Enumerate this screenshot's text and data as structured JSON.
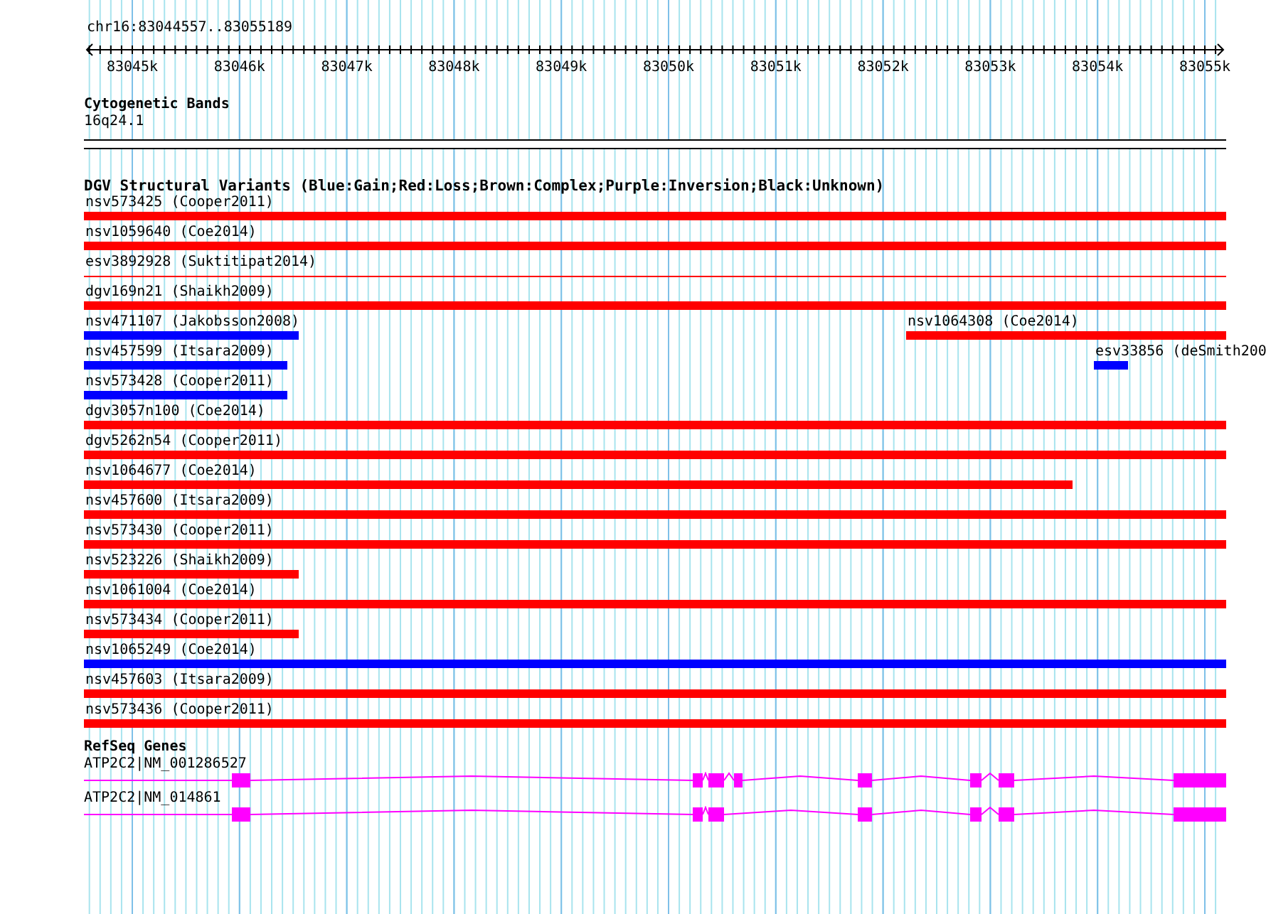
{
  "locus": "chr16:83044557..83055189",
  "ruler": {
    "ticks": [
      "83045k",
      "83046k",
      "83047k",
      "83048k",
      "83049k",
      "83050k",
      "83051k",
      "83052k",
      "83053k",
      "83054k",
      "83055k"
    ]
  },
  "cytogenetic_bands": {
    "title": "Cytogenetic Bands",
    "band": "16q24.1"
  },
  "dgv": {
    "title": "DGV Structural Variants (Blue:Gain;Red:Loss;Brown:Complex;Purple:Inversion;Black:Unknown)",
    "lanes": [
      {
        "features": [
          {
            "kind": "bar",
            "label": "nsv573425 (Cooper2011)",
            "color": "#ff0000"
          }
        ]
      },
      {
        "features": [
          {
            "kind": "bar",
            "label": "nsv1059640 (Coe2014)",
            "color": "#ff0000"
          }
        ]
      },
      {
        "features": [
          {
            "kind": "line",
            "label": "esv3892928 (Suktitipat2014)",
            "color": "#ff0000"
          }
        ]
      },
      {
        "features": [
          {
            "kind": "bar",
            "label": "dgv169n21 (Shaikh2009)",
            "color": "#ff0000"
          }
        ]
      },
      {
        "features": [
          {
            "kind": "bar",
            "label": "nsv471107 (Jakobsson2008)",
            "color": "#0000ff"
          },
          {
            "kind": "bar",
            "label": "nsv1064308 (Coe2014)",
            "color": "#ff0000"
          }
        ]
      },
      {
        "features": [
          {
            "kind": "bar",
            "label": "nsv457599 (Itsara2009)",
            "color": "#0000ff"
          },
          {
            "kind": "bar",
            "label": "esv33856 (deSmith200",
            "color": "#0000ff"
          }
        ]
      },
      {
        "features": [
          {
            "kind": "bar",
            "label": "nsv573428 (Cooper2011)",
            "color": "#0000ff"
          }
        ]
      },
      {
        "features": [
          {
            "kind": "bar",
            "label": "dgv3057n100 (Coe2014)",
            "color": "#ff0000"
          }
        ]
      },
      {
        "features": [
          {
            "kind": "bar",
            "label": "dgv5262n54 (Cooper2011)",
            "color": "#ff0000"
          }
        ]
      },
      {
        "features": [
          {
            "kind": "bar",
            "label": "nsv1064677 (Coe2014)",
            "color": "#ff0000"
          }
        ]
      },
      {
        "features": [
          {
            "kind": "bar",
            "label": "nsv457600 (Itsara2009)",
            "color": "#ff0000"
          }
        ]
      },
      {
        "features": [
          {
            "kind": "bar",
            "label": "nsv573430 (Cooper2011)",
            "color": "#ff0000"
          }
        ]
      },
      {
        "features": [
          {
            "kind": "bar",
            "label": "nsv523226 (Shaikh2009)",
            "color": "#ff0000"
          }
        ]
      },
      {
        "features": [
          {
            "kind": "bar",
            "label": "nsv1061004 (Coe2014)",
            "color": "#ff0000"
          }
        ]
      },
      {
        "features": [
          {
            "kind": "bar",
            "label": "nsv573434 (Cooper2011)",
            "color": "#ff0000"
          }
        ]
      },
      {
        "features": [
          {
            "kind": "bar",
            "label": "nsv1065249 (Coe2014)",
            "color": "#0000ff"
          }
        ]
      },
      {
        "features": [
          {
            "kind": "bar",
            "label": "nsv457603 (Itsara2009)",
            "color": "#ff0000"
          }
        ]
      },
      {
        "features": [
          {
            "kind": "bar",
            "label": "nsv573436 (Cooper2011)",
            "color": "#ff0000"
          }
        ]
      }
    ]
  },
  "refseq": {
    "title": "RefSeq Genes",
    "genes": [
      {
        "label": "ATP2C2|NM_001286527"
      },
      {
        "label": "ATP2C2|NM_014861"
      }
    ]
  }
}
